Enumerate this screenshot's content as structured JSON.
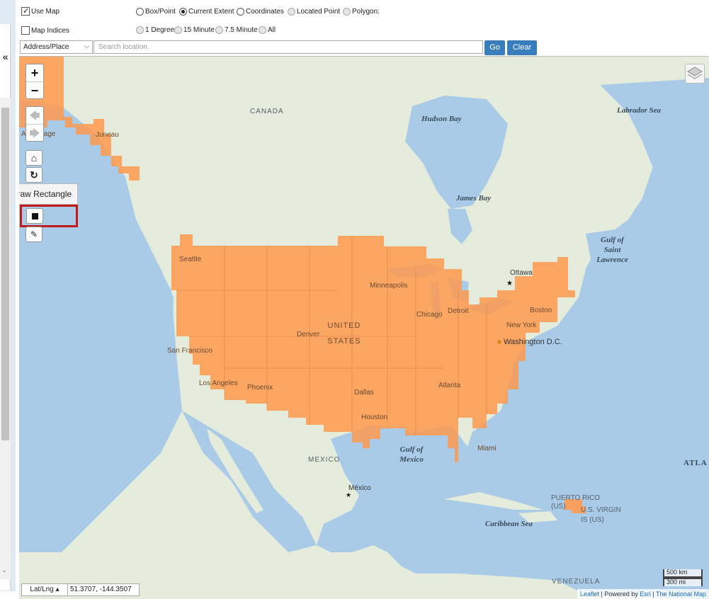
{
  "controls": {
    "use_map": {
      "label": "Use Map",
      "checked": true
    },
    "map_indices": {
      "label": "Map Indices",
      "checked": false
    },
    "extent_options": [
      {
        "label": "Box/Point",
        "checked": false,
        "enabled": true
      },
      {
        "label": "Current Extent",
        "checked": true,
        "enabled": true
      },
      {
        "label": "Coordinates",
        "checked": false,
        "enabled": true
      },
      {
        "label": "Located Point",
        "checked": false,
        "enabled": false
      },
      {
        "label": "Polygon:",
        "checked": false,
        "enabled": false
      }
    ],
    "index_options": [
      {
        "label": "1 Degree"
      },
      {
        "label": "15 Minute"
      },
      {
        "label": "7.5 Minute"
      },
      {
        "label": "All"
      }
    ],
    "address_select": "Address/Place",
    "search_placeholder": "Search location.",
    "go_label": "Go",
    "clear_label": "Clear"
  },
  "sidebar": {
    "collapse_glyph": "«"
  },
  "map": {
    "tooltip": "Draw Rectangle",
    "water_labels": {
      "hudson_bay": "Hudson Bay",
      "labrador_sea": "Labrador Sea",
      "james_bay": "James Bay",
      "gulf_st_lawrence": "Gulf of Saint Lawrence",
      "gulf_mexico": "Gulf of Mexico",
      "caribbean": "Caribbean Sea",
      "atlantic": "ATLA"
    },
    "land_labels": {
      "canada": "CANADA",
      "united_states": "UNITED STATES",
      "mexico": "MEXICO",
      "venezuela": "VENEZUELA",
      "puerto_rico": "PUERTO RICO (US)",
      "virgin_islands": "U.S. VIRGIN IS (US)"
    },
    "cities": {
      "ottawa": "Ottawa",
      "washington": "Washington D.C.",
      "mexico_city": "México",
      "seattle": "Seattle",
      "san_francisco": "San Francisco",
      "los_angeles": "Los Angeles",
      "phoenix": "Phoenix",
      "denver": "Denver",
      "minneapolis": "Minneapolis",
      "chicago": "Chicago",
      "detroit": "Detroit",
      "boston": "Boston",
      "new_york": "New York",
      "dallas": "Dallas",
      "houston": "Houston",
      "atlanta": "Atlanta",
      "miami": "Miami",
      "juneau": "Juneau",
      "anchorage": "Anchorage"
    },
    "latlng_mode": "Lat/Lng",
    "latlng_value": "51.3707, -144.3507",
    "scale_km": "500 km",
    "scale_mi": "300 mi",
    "attribution": {
      "leaflet": "Leaflet",
      "powered": "| Powered by",
      "esri": "Esri",
      "sep": "|",
      "nationalmap": "The National Map"
    },
    "colors": {
      "selection": "#ff9a4f",
      "water": "#a9cbe8",
      "land": "#e9eedd",
      "highlight": "#c01a1a",
      "button": "#3a7dbd"
    }
  }
}
